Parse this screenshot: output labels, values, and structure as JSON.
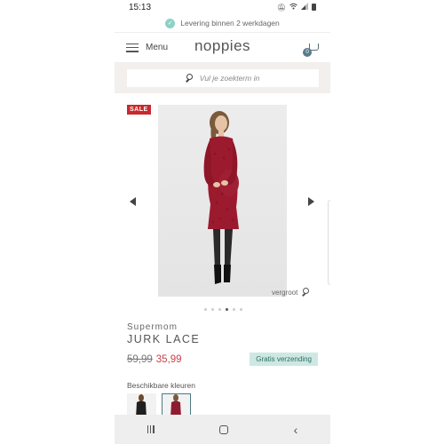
{
  "status_bar": {
    "time": "15:13",
    "icons": [
      "mute-icon",
      "wifi-icon",
      "signal-icon",
      "battery-icon"
    ]
  },
  "delivery_notice": {
    "text": "Levering binnen 2 werkdagen",
    "icon": "check-circle-icon"
  },
  "header": {
    "menu_label": "Menu",
    "logo_text": "noppies",
    "cart_count": "0"
  },
  "search": {
    "placeholder": "Vul je zoekterm in"
  },
  "gallery": {
    "sale_badge": "SALE",
    "enlarge_label": "vergroot",
    "dot_count": 6,
    "active_dot": 4,
    "dress_color": "#9c1a2e"
  },
  "product": {
    "brand": "Supermom",
    "title": "JURK LACE",
    "old_price": "59,99",
    "new_price": "35,99",
    "shipping_badge": "Gratis verzending",
    "colors_label": "Beschikbare kleuren",
    "swatch_colors": [
      "#1f1f1f",
      "#8e1c30"
    ]
  },
  "colors": {
    "sale_red": "#c9282d",
    "price_red": "#c9404a",
    "badge_teal_bg": "#cde8e2",
    "search_bg": "#f3efec"
  }
}
